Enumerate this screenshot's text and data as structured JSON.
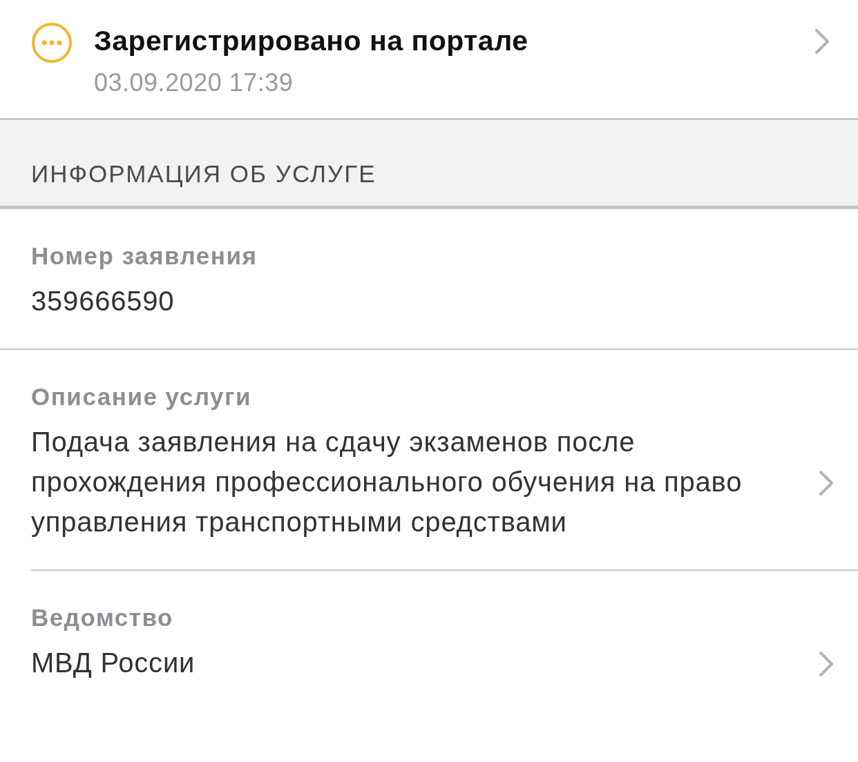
{
  "status": {
    "kind": "pending",
    "title": "Зарегистрировано на портале",
    "date": "03.09.2020 17:39",
    "has_link": true
  },
  "section": {
    "title": "ИНФОРМАЦИЯ ОБ УСЛУГЕ"
  },
  "fields": [
    {
      "label": "Номер заявления",
      "value": "359666590",
      "has_link": false
    },
    {
      "label": "Описание услуги",
      "value": "Подача заявления на сдачу экзаменов после прохождения профессионального обучения на право управления транспортными средствами",
      "has_link": true
    },
    {
      "label": "Ведомство",
      "value": "МВД России",
      "has_link": true
    }
  ]
}
